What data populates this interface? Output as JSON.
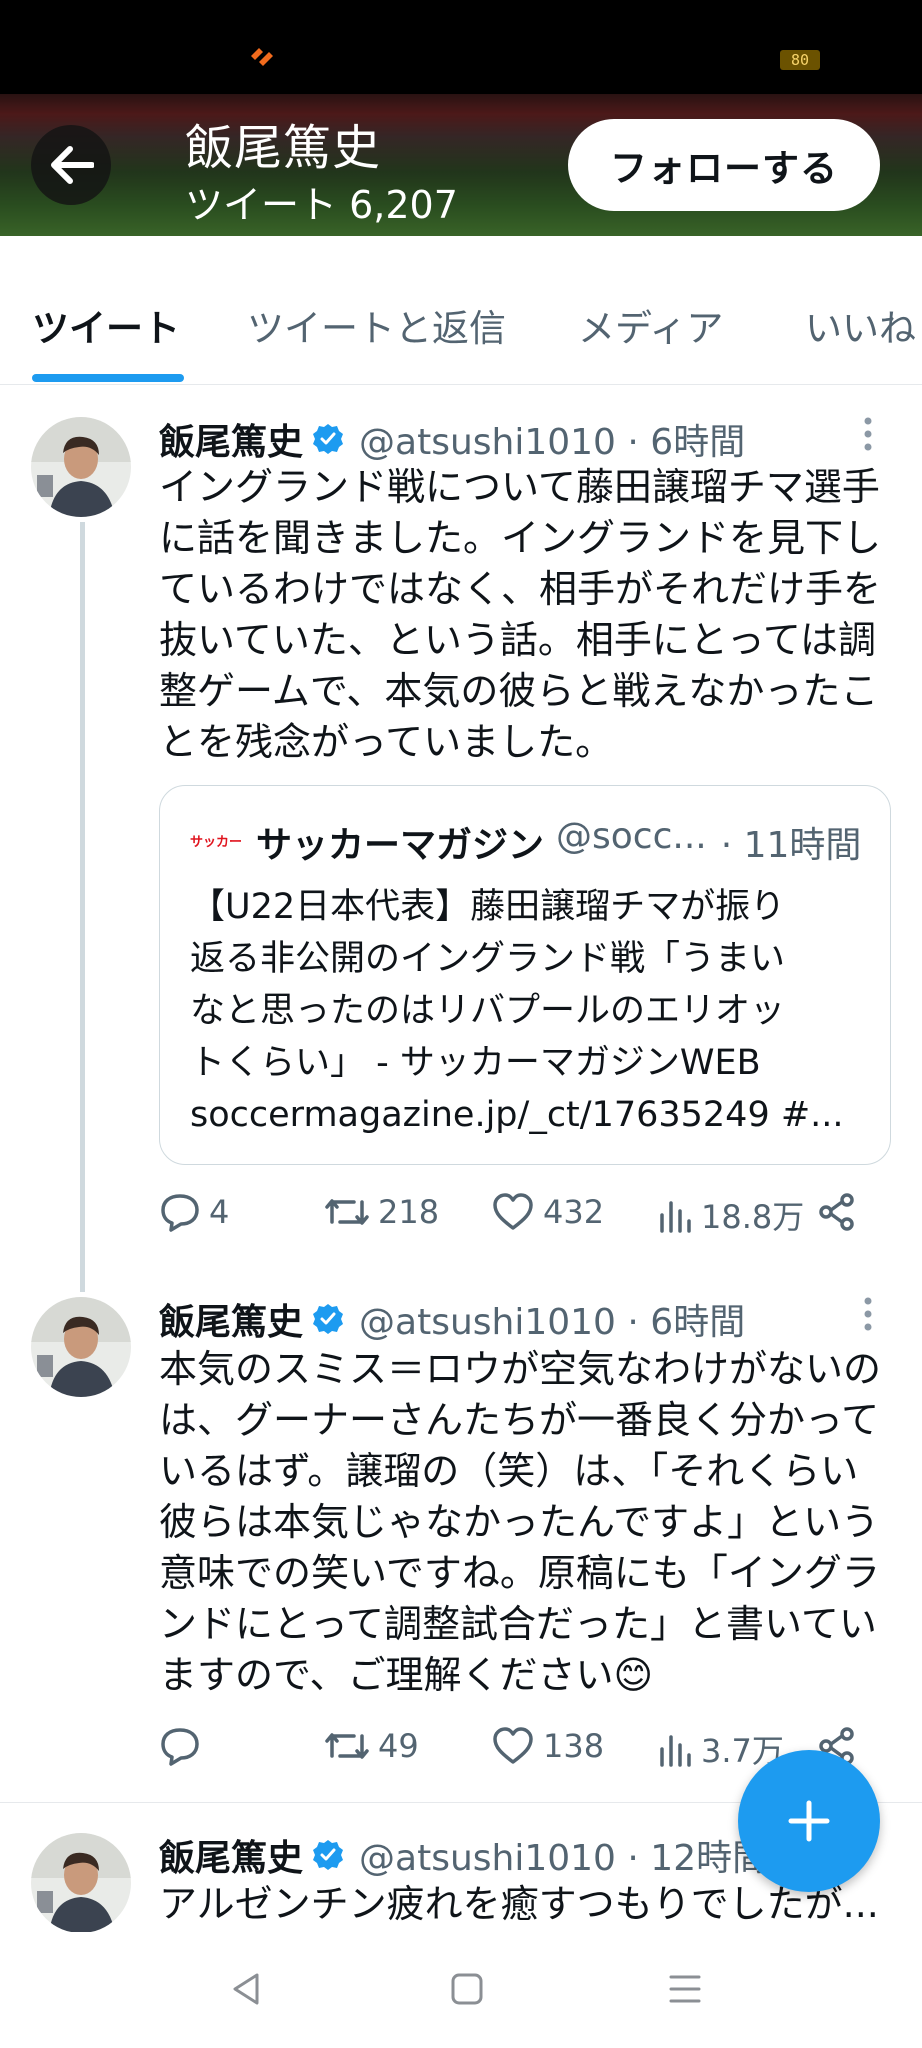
{
  "status_bar": {
    "battery": "80",
    "app_icon": "app-logo-icon"
  },
  "header": {
    "name": "飯尾篤史",
    "tweet_count": "ツイート 6,207",
    "follow_label": "フォローする"
  },
  "tabs": [
    {
      "label": "ツイート",
      "active": true
    },
    {
      "label": "ツイートと返信",
      "active": false
    },
    {
      "label": "メディア",
      "active": false
    },
    {
      "label": "いいね",
      "active": false
    }
  ],
  "tweets": [
    {
      "name": "飯尾篤史",
      "handle": "@atsushi1010 · 6時間",
      "text": "イングランド戦について藤田譲瑠チマ選手\nに話を聞きました。イングランドを見下し\nているわけではなく、相手がそれだけ手を\n抜いていた、という話。相手にとっては調\n整ゲームで、本気の彼らと戦えなかったこ\nとを残念がっていました。",
      "quote": {
        "source_name": "サッカーマガジン",
        "source_handle": "@socc...",
        "time": "· 11時間",
        "logo_text": "サッカー",
        "text": "【U22日本代表】藤田譲瑠チマが振り\n返る非公開のイングランド戦「うまい\nなと思ったのはリバプールのエリオッ\nトくらい」 - サッカーマガジンWEB\nsoccermagazine.jp/_ct/17635249 #..."
      },
      "replies": "4",
      "retweets": "218",
      "likes": "432",
      "views": "18.8万"
    },
    {
      "name": "飯尾篤史",
      "handle": "@atsushi1010 · 6時間",
      "text": "本気のスミス＝ロウが空気なわけがないの\nは、グーナーさんたちが一番良く分かって\nいるはず。譲瑠の（笑）は、「それくらい\n彼らは本気じゃなかったんですよ」という\n意味での笑いですね。原稿にも「イングラ\nンドにとって調整試合だった」と書いてい\nますので、ご理解ください😊",
      "replies": "",
      "retweets": "49",
      "likes": "138",
      "views": "3.7万"
    },
    {
      "name": "飯尾篤史",
      "handle": "@atsushi1010 · 12時間",
      "text": "アルゼンチン疲れを癒すつもりでしたが..."
    }
  ],
  "colors": {
    "accent": "#1d9bf0",
    "text_secondary": "#536471",
    "border": "#cfd9de"
  }
}
